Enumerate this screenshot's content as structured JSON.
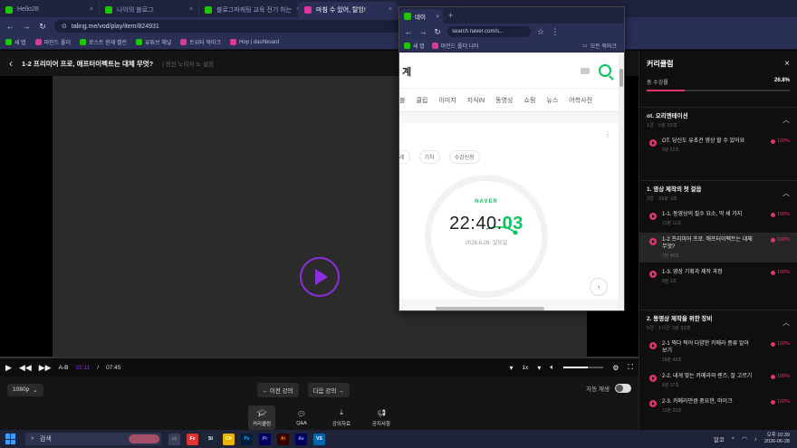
{
  "browser": {
    "tabs": [
      {
        "label": "Hello28",
        "favicon": "green"
      },
      {
        "label": "나이의 블로그",
        "favicon": "green"
      },
      {
        "label": "블로그마케팅 교육 전기 하는",
        "favicon": "green"
      },
      {
        "label": "마침 수 있어, 탈잉!",
        "favicon": "pink",
        "active": true
      }
    ],
    "url": "taling.me/vod/play/item/824931",
    "bookmarks": [
      "새 탭",
      "마인드 폴더",
      "로스트 현재 챌린",
      "유튜브 채널",
      "트위터 북마크",
      "Hop | dashboard"
    ]
  },
  "player": {
    "lesson_title": "1-2 프리미어 프로, 애프터이펙트는 대체 무엇?",
    "lesson_subtitle": "| 정신 노이저 노 설정",
    "time_current": "02:11",
    "time_separator": "/",
    "time_total": "07:45",
    "ab_label": "A-B",
    "speed": "1x",
    "volume": 0.6,
    "progress": 0.0,
    "quality": "1080p",
    "prev_label": "← 이전 강의",
    "next_label": "다음 강의 →",
    "autoplay_label": "자동 재생",
    "autoplay_on": false,
    "tools": [
      {
        "icon": "graduation-cap-icon",
        "label": "커리큘럼",
        "active": true
      },
      {
        "icon": "chat-icon",
        "label": "Q&A"
      },
      {
        "icon": "download-icon",
        "label": "강의자료"
      },
      {
        "icon": "megaphone-icon",
        "label": "공지사항"
      }
    ]
  },
  "curriculum": {
    "title": "커리큘럼",
    "progress_label": "총 수강률",
    "progress_pct": "26.8%",
    "progress": 0.268,
    "sections": [
      {
        "title": "ot. 오리엔테이션",
        "meta": "1강 · 5분 52초",
        "lessons": [
          {
            "title": "OT. 당신도 유초건 영상 할 수 있어요",
            "dur": "5분 52초",
            "pct": "100%"
          }
        ]
      },
      {
        "title": "1. 영상 제작의 첫 걸음",
        "meta": "3강 · 29분 3초",
        "lessons": [
          {
            "title": "1-1. 동영상의 필수 요소, 딱 세 가지",
            "dur": "13분 11초",
            "pct": "100%"
          },
          {
            "title": "1-2 프리미어 프로, 애프터이펙트는 대체 무엇?",
            "dur": "7분 48초",
            "pct": "100%",
            "current": true
          },
          {
            "title": "1-3. 영상 기획과 제작 과정",
            "dur": "8분 3초",
            "pct": "100%"
          }
        ]
      },
      {
        "title": "2. 동영상 제작을 위한 장비",
        "meta": "5강 · 1시간 3분 33초",
        "lessons": [
          {
            "title": "2-1 찍다 찍어 다양한 카메라 종류 알아보기",
            "dur": "18분 48초",
            "pct": "100%"
          },
          {
            "title": "2-2. 내게 맞는 카메라와 렌즈, 잘 고르기",
            "dur": "8분 17초",
            "pct": "100%"
          },
          {
            "title": "2-3. 카메라만큼 중요한, 마이크",
            "dur": "13분 20초",
            "pct": "100%"
          }
        ]
      }
    ]
  },
  "naver_window": {
    "tab_label": "네이",
    "url": "search.naver.com/s...",
    "bookmarks": [
      "새 탭",
      "마인드 폴더 나타",
      "모든 북마크"
    ],
    "search_text": "계",
    "menu": [
      "블",
      "클립",
      "이미지",
      "지식iN",
      "동영상",
      "쇼핑",
      "뉴스",
      "어학사전"
    ],
    "subtabs": [
      "레",
      "기차",
      "수강신청"
    ],
    "clock_brand": "NAVER",
    "clock_hm": "22:40:",
    "clock_sec": "03",
    "clock_date": "2026.6.28. 일요일"
  },
  "taskbar": {
    "search_label": "검색",
    "apps": [
      "Fe",
      "St",
      "Ch",
      "Ps",
      "Pr",
      "Ai",
      "Ae",
      "VS"
    ],
    "tray_label": "알코",
    "time": "오후 10:39",
    "date": "2026-06-28"
  },
  "colors": {
    "accent": "#8b2ee0",
    "progress": "#e2336b",
    "naver": "#03c75a"
  }
}
